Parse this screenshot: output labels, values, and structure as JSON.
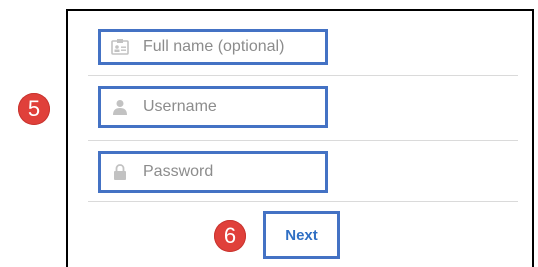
{
  "form": {
    "fields": [
      {
        "name": "full-name",
        "placeholder": "Full name (optional)",
        "icon": "id-card-icon"
      },
      {
        "name": "username",
        "placeholder": "Username",
        "icon": "person-icon"
      },
      {
        "name": "password",
        "placeholder": "Password",
        "icon": "lock-icon"
      }
    ],
    "next_label": "Next"
  },
  "annotations": {
    "step_fields": "5",
    "step_next": "6"
  },
  "colors": {
    "highlight_border": "#4472c4",
    "badge": "#e0403a",
    "button_text": "#2f6fc4",
    "placeholder_text": "#8c8c8c",
    "icon": "#c2c2c2"
  }
}
